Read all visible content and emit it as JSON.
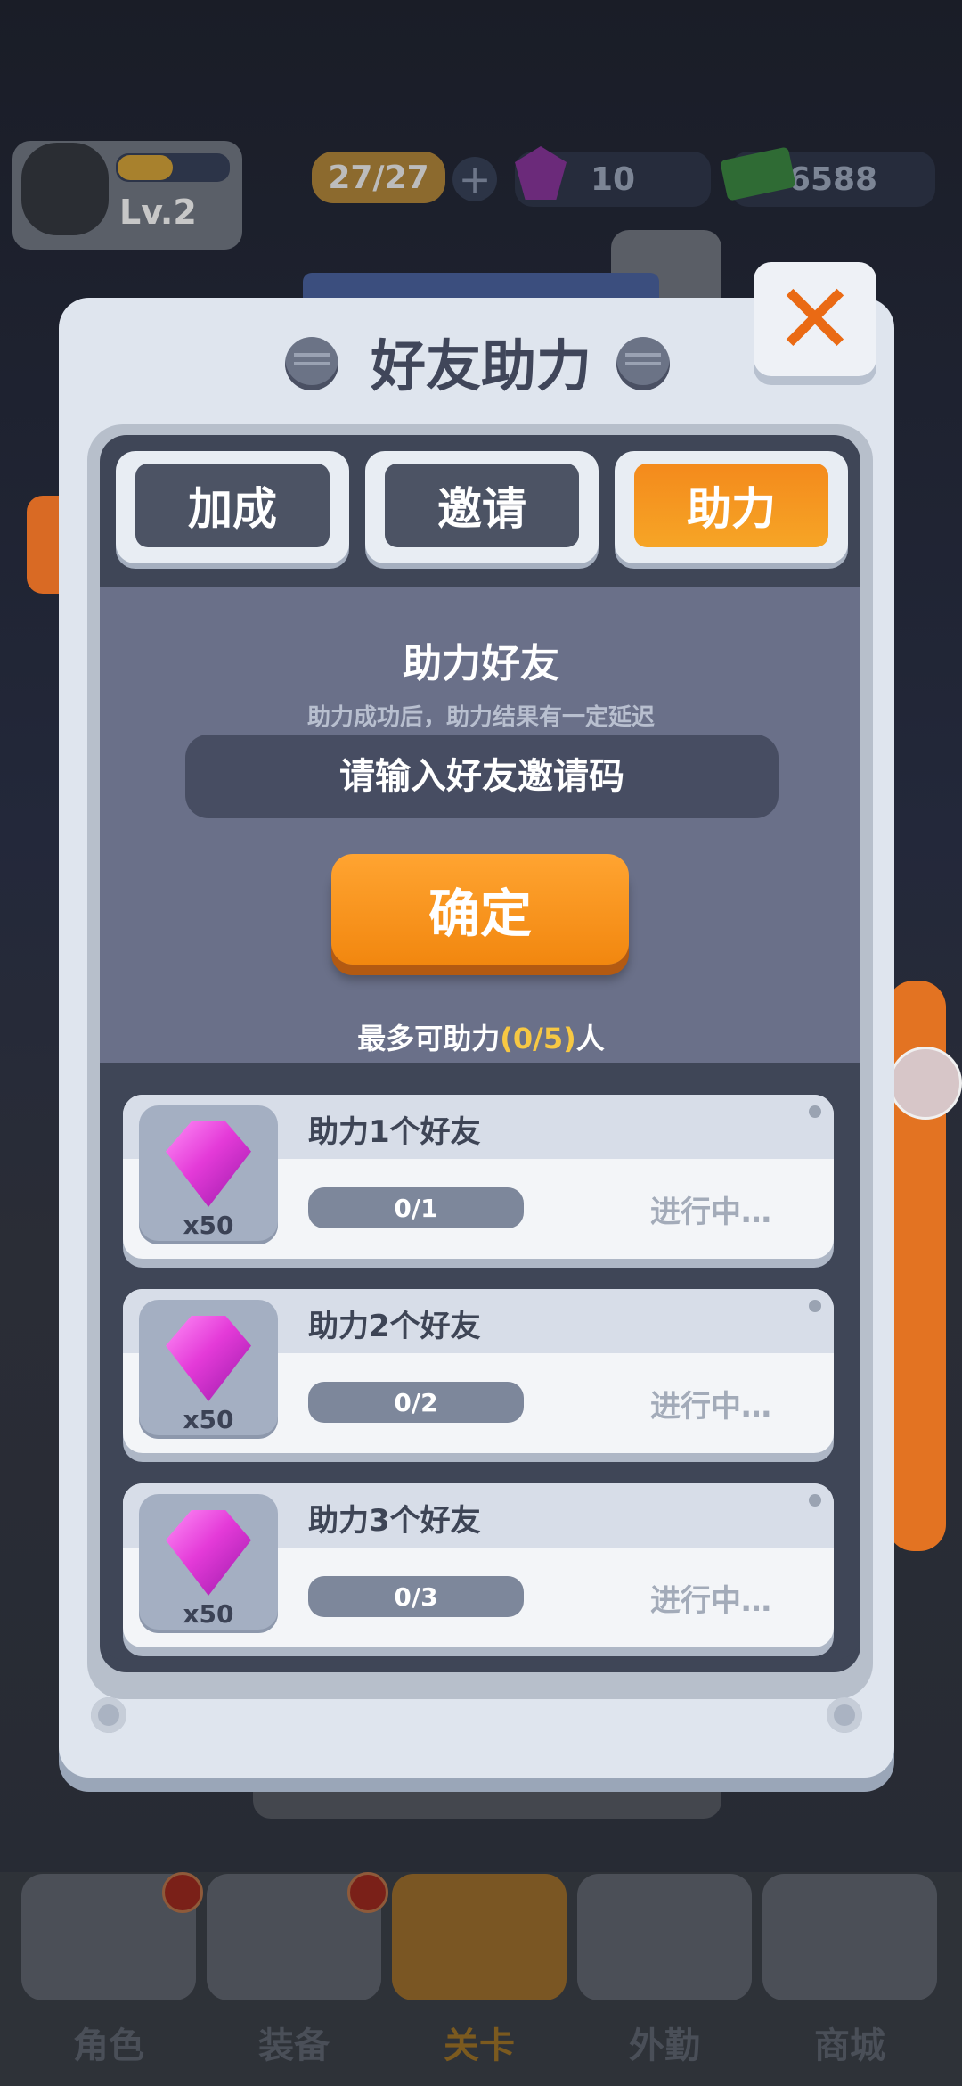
{
  "background": {
    "player": {
      "level": "Lv.2"
    },
    "resources": {
      "energy": "27/27",
      "gems": "10",
      "cash": "6588"
    },
    "bottom_nav": [
      {
        "label": "角色",
        "active": false
      },
      {
        "label": "装备",
        "active": false
      },
      {
        "label": "关卡",
        "active": true
      },
      {
        "label": "外勤",
        "active": false
      },
      {
        "label": "商城",
        "active": false
      }
    ]
  },
  "modal": {
    "title": "好友助力",
    "close_icon": "close-x",
    "tabs": [
      {
        "label": "加成",
        "active": false
      },
      {
        "label": "邀请",
        "active": false
      },
      {
        "label": "助力",
        "active": true
      }
    ],
    "heading": "助力好友",
    "subtitle": "助力成功后，助力结果有一定延迟",
    "input_placeholder": "请输入好友邀请码",
    "confirm_label": "确定",
    "max_info": {
      "prefix": "最多可助力",
      "count": "(0/5)",
      "suffix": "人"
    },
    "rewards": [
      {
        "label": "助力1个好友",
        "progress": "0/1",
        "status": "进行中…",
        "reward_qty": "x50",
        "icon": "gem-icon"
      },
      {
        "label": "助力2个好友",
        "progress": "0/2",
        "status": "进行中…",
        "reward_qty": "x50",
        "icon": "gem-icon"
      },
      {
        "label": "助力3个好友",
        "progress": "0/3",
        "status": "进行中…",
        "reward_qty": "x50",
        "icon": "gem-icon"
      }
    ]
  },
  "colors": {
    "accent": "#f48a1c",
    "highlight": "#f7c843",
    "panel": "#3f4657"
  }
}
